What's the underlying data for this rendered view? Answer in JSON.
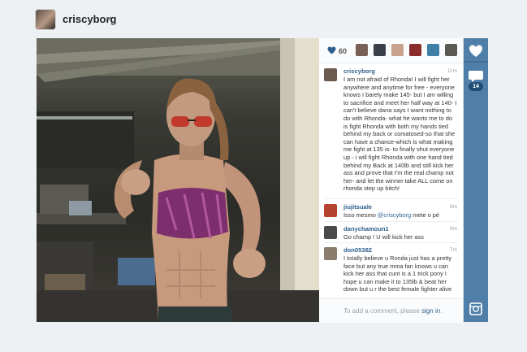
{
  "header": {
    "username": "criscyborg"
  },
  "likes": {
    "count": "60",
    "liker_colors": [
      "#7a5f55",
      "#3b3f4a",
      "#c9a28e",
      "#8c2b2b",
      "#3f7fa8",
      "#5a5a52"
    ]
  },
  "comments": [
    {
      "username": "criscyborg",
      "time": "11m",
      "text": "I am not afraid of Rhonda! I will fight her anywhere and anytime for free - everyone knows I barely make 145- but I am willing to sacrifice and meet her half way at 140- I can't believe dana says I want nothing to do with Rhonda- what he wants me to do is fight Rhonda with both my hands tied behind my back or comatosed-so that she can have a chance-which is what making me fight at 135 is- to finally shut everyone up - i will fight Rhonda with one hand tied behind my Back at 140lb and still kick her ass and prove that I'm the real champ not her- and let the winner take ALL come on rhonda step up bitch!",
      "avatar_color": "#6d5a4e"
    },
    {
      "username": "jiujitsuale",
      "time": "9m",
      "text_before": "Isso mesmo ",
      "mention": "@criscyborg",
      "text_after": " mete o pé",
      "avatar_color": "#b5432f"
    },
    {
      "username": "danychamoun1",
      "time": "8m",
      "text": "Go champ ! U will kick her ass",
      "avatar_color": "#4a4a4a"
    },
    {
      "username": "don05382",
      "time": "7m",
      "text": "I totally believe u Ronda just has a pretty face but any true mma fan knows u can kick her ass that cunt is a 1 trick pony I hope u can make it to 135lb & beat her down but u r the best female fighter alive",
      "avatar_color": "#8b7d6b"
    }
  ],
  "add_comment": {
    "prefix": "To add a comment, please ",
    "link": "sign in",
    "suffix": "."
  },
  "actions": {
    "comment_count": "14",
    "accent_color": "#4f7ea8"
  }
}
